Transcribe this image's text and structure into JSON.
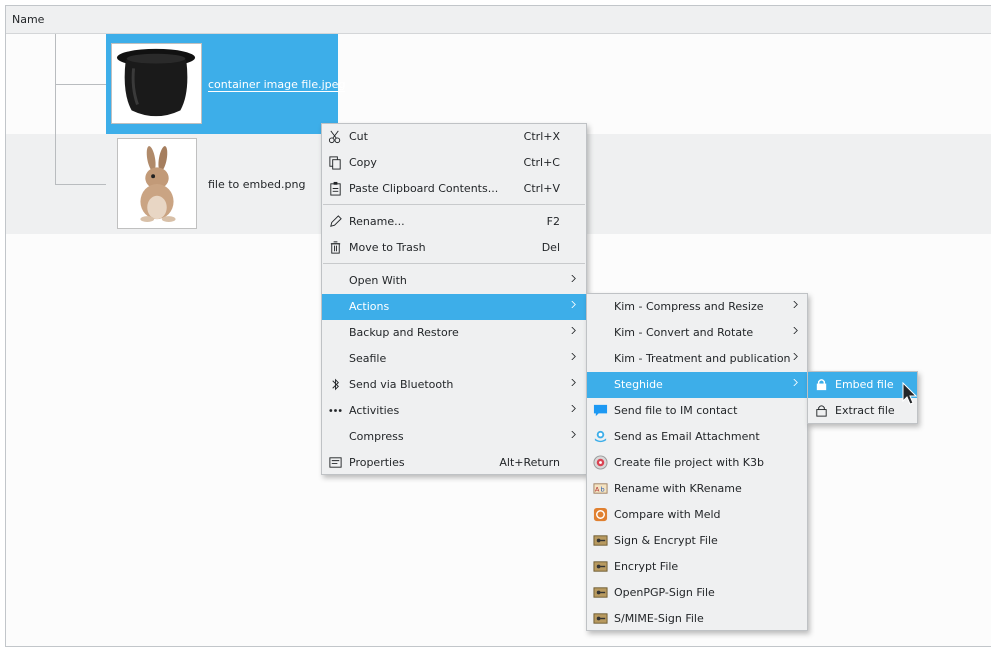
{
  "view": {
    "header_name": "Name"
  },
  "files": [
    {
      "name": "container image file.jpeg"
    },
    {
      "name": "file to embed.png"
    }
  ],
  "context_menu": {
    "items": [
      {
        "label": "Cut",
        "shortcut": "Ctrl+X",
        "icon": "scissors-icon"
      },
      {
        "label": "Copy",
        "shortcut": "Ctrl+C",
        "icon": "copy-icon"
      },
      {
        "label": "Paste Clipboard Contents...",
        "shortcut": "Ctrl+V",
        "icon": "paste-icon"
      },
      {
        "label": "Rename...",
        "shortcut": "F2",
        "icon": "pencil-icon"
      },
      {
        "label": "Move to Trash",
        "shortcut": "Del",
        "icon": "trash-icon"
      },
      {
        "label": "Open With",
        "icon": ""
      },
      {
        "label": "Actions",
        "icon": ""
      },
      {
        "label": "Backup and Restore",
        "icon": ""
      },
      {
        "label": "Seafile",
        "icon": ""
      },
      {
        "label": "Send via Bluetooth",
        "icon": "bluetooth-icon"
      },
      {
        "label": "Activities",
        "icon": "dots-icon"
      },
      {
        "label": "Compress",
        "icon": ""
      },
      {
        "label": "Properties",
        "shortcut": "Alt+Return",
        "icon": "properties-icon"
      }
    ]
  },
  "actions_menu": {
    "items": [
      {
        "label": "Kim - Compress and Resize"
      },
      {
        "label": "Kim - Convert and Rotate"
      },
      {
        "label": "Kim - Treatment and publication"
      },
      {
        "label": "Steghide"
      },
      {
        "label": "Send file to IM contact",
        "icon": "chat-bubble-icon"
      },
      {
        "label": "Send as Email Attachment",
        "icon": "email-icon"
      },
      {
        "label": "Create file project with K3b",
        "icon": "k3b-icon"
      },
      {
        "label": "Rename with KRename",
        "icon": "krename-icon"
      },
      {
        "label": "Compare with Meld",
        "icon": "meld-icon"
      },
      {
        "label": "Sign & Encrypt File",
        "icon": "kgpg-icon"
      },
      {
        "label": "Encrypt File",
        "icon": "kgpg-icon"
      },
      {
        "label": "OpenPGP-Sign File",
        "icon": "kgpg-icon"
      },
      {
        "label": "S/MIME-Sign File",
        "icon": "kgpg-icon"
      }
    ]
  },
  "steghide_menu": {
    "items": [
      {
        "label": "Embed file",
        "icon": "lock-icon"
      },
      {
        "label": "Extract file",
        "icon": "unlock-icon"
      }
    ]
  },
  "colors": {
    "highlight": "#3daee9",
    "menu_bg": "#eff0f1",
    "text": "#232629"
  }
}
